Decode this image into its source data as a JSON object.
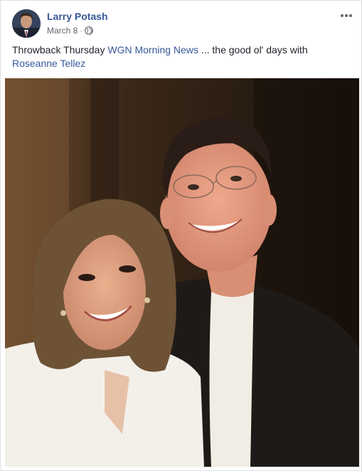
{
  "post": {
    "author": "Larry Potash",
    "date": "March 8",
    "separator": "·",
    "privacy_icon": "globe-icon",
    "more_icon": "more-options-icon",
    "text_before": "Throwback Thursday ",
    "link1": "WGN Morning News",
    "text_middle": " ... the good ol' days with",
    "link2": "Roseanne Tellez"
  },
  "colors": {
    "link": "#365899",
    "author": "#385898",
    "meta": "#616770"
  }
}
